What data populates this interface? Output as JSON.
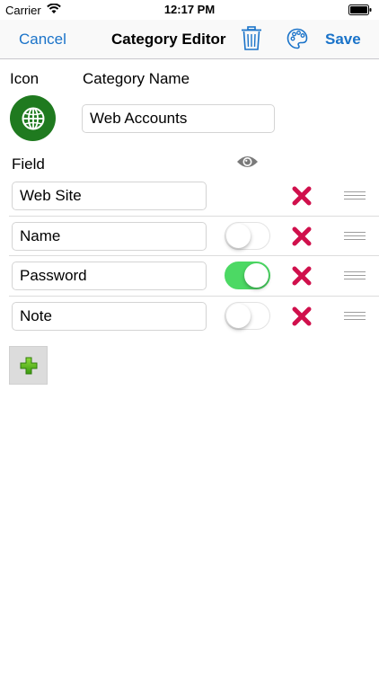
{
  "status_bar": {
    "carrier": "Carrier",
    "time": "12:17 PM"
  },
  "nav": {
    "cancel": "Cancel",
    "title": "Category Editor",
    "save": "Save"
  },
  "labels": {
    "icon": "Icon",
    "category_name": "Category Name",
    "field": "Field"
  },
  "category_name_value": "Web Accounts",
  "fields": [
    {
      "name": "Web Site",
      "has_toggle": false,
      "hidden": false
    },
    {
      "name": "Name",
      "has_toggle": true,
      "hidden": false
    },
    {
      "name": "Password",
      "has_toggle": true,
      "hidden": true
    },
    {
      "name": "Note",
      "has_toggle": true,
      "hidden": false
    }
  ],
  "colors": {
    "accent": "#1a73c9",
    "icon_bg": "#1f7a1f",
    "delete": "#d0104c",
    "toggle_on": "#4cd964",
    "add": "#4caf1f"
  },
  "icons": [
    "wifi-icon",
    "battery-icon",
    "trash-icon",
    "palette-icon",
    "globe-icon",
    "eye-icon",
    "delete-icon",
    "drag-handle-icon",
    "plus-icon"
  ]
}
